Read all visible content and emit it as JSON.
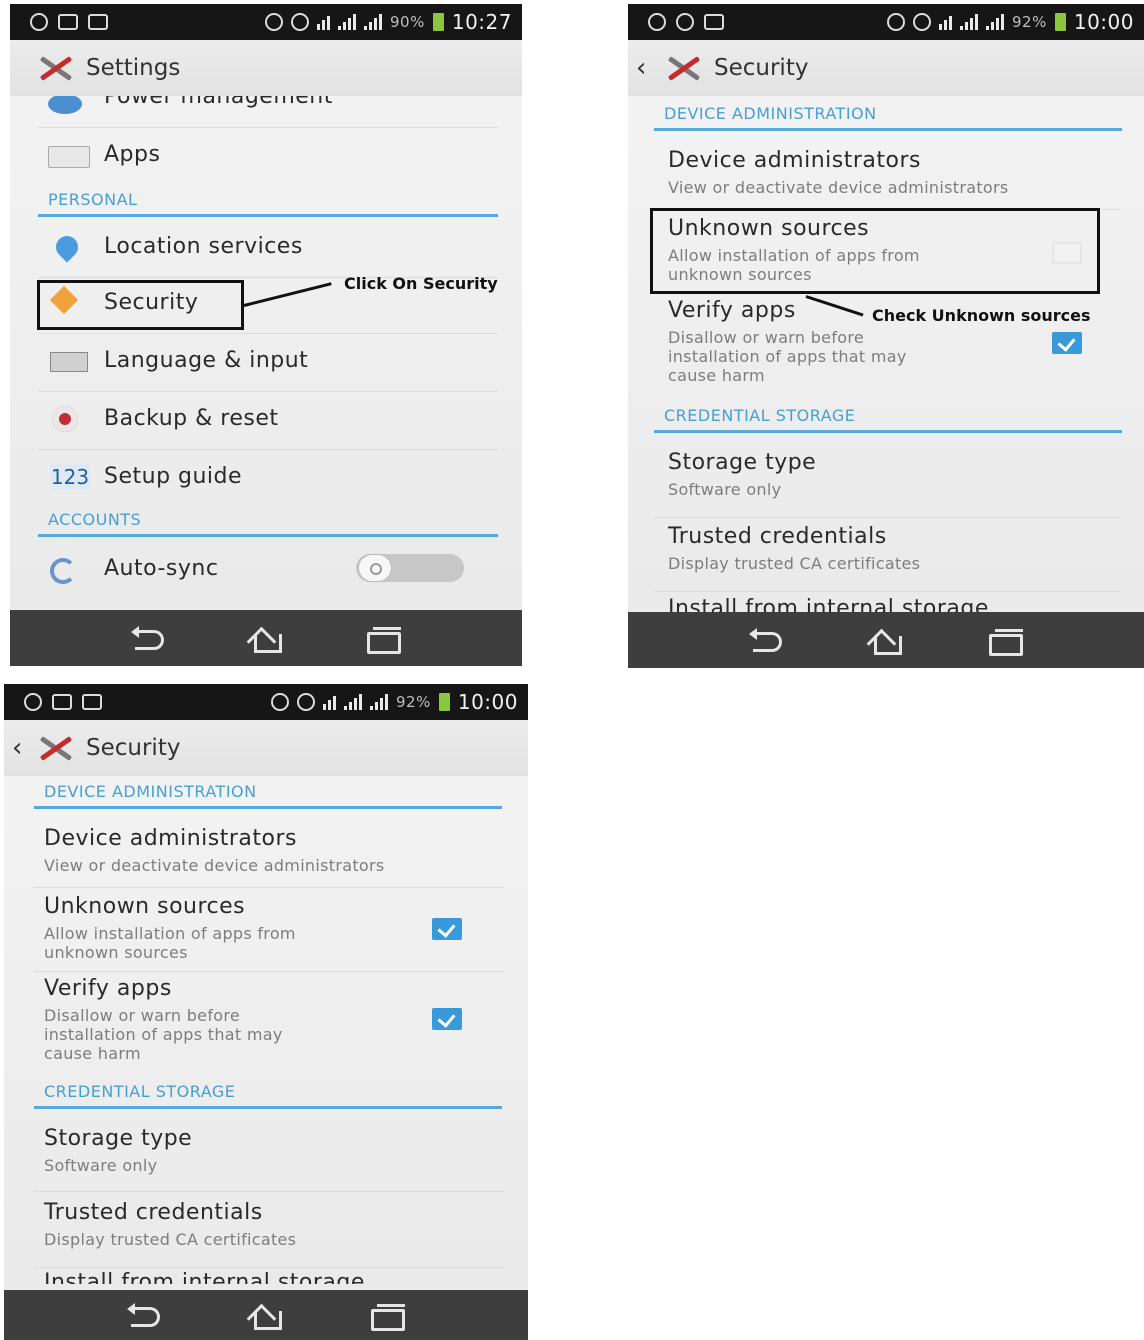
{
  "status_bars": {
    "phone1": {
      "battery": "90%",
      "time": "10:27"
    },
    "phone2": {
      "battery": "92%",
      "time": "10:00"
    },
    "phone3": {
      "battery": "92%",
      "time": "10:00"
    }
  },
  "settings_screen": {
    "title": "Settings",
    "items_top": [
      {
        "label": "Power management",
        "icon": "power-icon"
      },
      {
        "label": "Apps",
        "icon": "apps-icon"
      }
    ],
    "personal_header": "PERSONAL",
    "personal_items": [
      {
        "label": "Location services",
        "icon": "location-icon"
      },
      {
        "label": "Security",
        "icon": "security-icon"
      },
      {
        "label": "Language & input",
        "icon": "keyboard-icon"
      },
      {
        "label": "Backup & reset",
        "icon": "backup-icon"
      },
      {
        "label": "Setup guide",
        "icon": "setup-guide-icon",
        "icon_text": "123"
      }
    ],
    "accounts_header": "ACCOUNTS",
    "account_items": [
      {
        "label": "Auto-sync",
        "icon": "sync-icon",
        "toggle": "off"
      }
    ],
    "annotation": "Click On Security"
  },
  "security_screen": {
    "title": "Security",
    "device_admin_header": "DEVICE ADMINISTRATION",
    "device_administrators": {
      "title": "Device administrators",
      "subtitle": "View or deactivate device administrators"
    },
    "unknown_sources": {
      "title": "Unknown sources",
      "subtitle_line1": "Allow installation of apps from",
      "subtitle_line2": "unknown sources"
    },
    "verify_apps": {
      "title": "Verify apps",
      "subtitle_line1": "Disallow or warn before",
      "subtitle_line2": "installation of apps that may",
      "subtitle_line3": "cause harm"
    },
    "credential_header": "CREDENTIAL STORAGE",
    "storage_type": {
      "title": "Storage type",
      "subtitle": "Software only"
    },
    "trusted_credentials": {
      "title": "Trusted credentials",
      "subtitle": "Display trusted CA certificates"
    },
    "install_from_storage": {
      "title": "Install from internal storage"
    }
  },
  "phone2_state": {
    "unknown_sources_checked": false,
    "verify_apps_checked": true,
    "annotation": "Check Unknown sources"
  },
  "phone3_state": {
    "unknown_sources_checked": true,
    "verify_apps_checked": true
  },
  "colors": {
    "accent": "#45a0d6",
    "checkbox": "#3a9ad9",
    "navbar": "#3e3e3e",
    "statusbar": "#161616"
  }
}
